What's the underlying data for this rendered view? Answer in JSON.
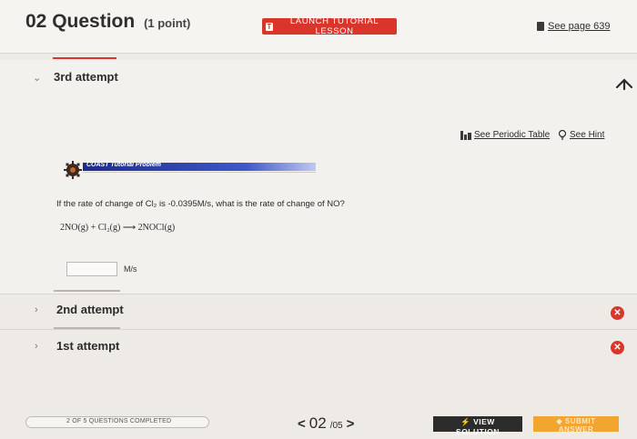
{
  "header": {
    "question_number": "02",
    "question_word": "Question",
    "points": "(1 point)",
    "launch_label": "LAUNCH TUTORIAL LESSON",
    "see_page": "See page 639"
  },
  "attempt_current": {
    "label": "3rd attempt",
    "see_periodic_table": "See Periodic Table",
    "see_hint": "See Hint",
    "coast_label": "COAST Tutorial Problem",
    "question_text": "If the rate of change of Cl₂ is -0.0395M/s, what is the rate of change of NO?",
    "equation": "2NO(g) + Cl₂(g) ⟶ 2NOCl(g)",
    "answer_value": "",
    "unit": "M/s"
  },
  "previous_attempts": [
    {
      "label": "2nd attempt"
    },
    {
      "label": "1st attempt"
    }
  ],
  "footer": {
    "progress_text": "2 OF 5 QUESTIONS COMPLETED",
    "progress_fraction": 0.4,
    "current_page": "02",
    "total_pages": "/05",
    "view_solution": "VIEW SOLUTION",
    "submit_answer": "SUBMIT ANSWER"
  },
  "icons": {
    "collapse": "arrow-up-icon",
    "status": "x-circle-icon",
    "book": "book-icon",
    "periodic": "periodic-table-icon",
    "hint": "lightbulb-icon"
  },
  "colors": {
    "accent_red": "#d9352b",
    "submit_orange": "#f2a531",
    "view_dark": "#2c2c2c",
    "coast_blue": "#1d2c8c"
  }
}
